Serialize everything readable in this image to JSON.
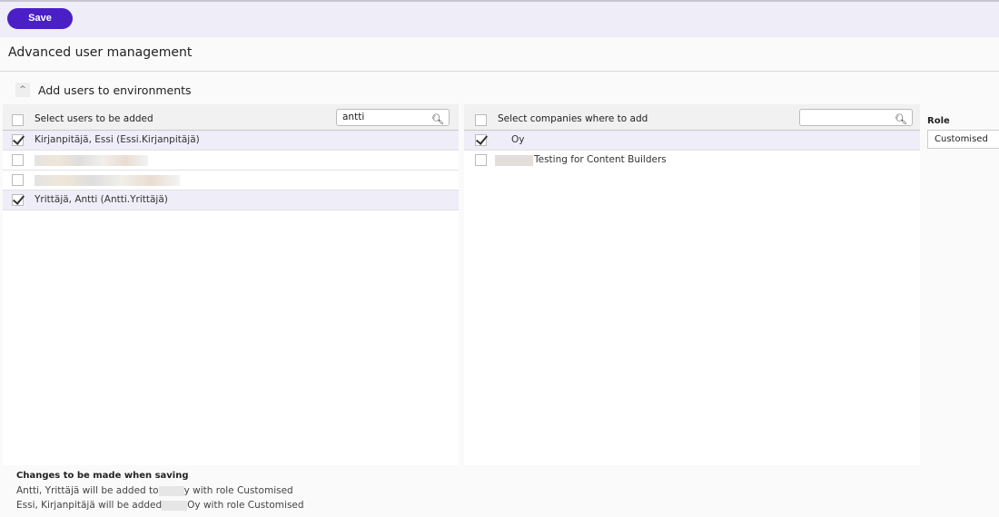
{
  "toolbar": {
    "save_label": "Save"
  },
  "page": {
    "title": "Advanced user management",
    "section_title": "Add users to environments"
  },
  "users": {
    "header": "Select users to be added",
    "search_value": "antti",
    "items": [
      {
        "label": "Kirjanpitäjä, Essi (Essi.Kirjanpitäjä)",
        "checked": true
      },
      {
        "label": "",
        "checked": false
      },
      {
        "label": "",
        "checked": false
      },
      {
        "label": "Yrittäjä, Antti (Antti.Yrittäjä)",
        "checked": true
      }
    ]
  },
  "companies": {
    "header": "Select companies where to add",
    "search_value": "",
    "items": [
      {
        "label": "Oy",
        "checked": true
      },
      {
        "label": "Testing for Content Builders",
        "checked": false
      }
    ]
  },
  "role": {
    "label": "Role",
    "value": "Customised"
  },
  "changes": {
    "title": "Changes to be made when saving",
    "line1_a": "Antti, Yrittäjä will be added to",
    "line1_b": "y with role Customised",
    "line2_a": "Essi, Kirjanpitäjä will be added",
    "line2_b": "Oy with role Customised"
  }
}
